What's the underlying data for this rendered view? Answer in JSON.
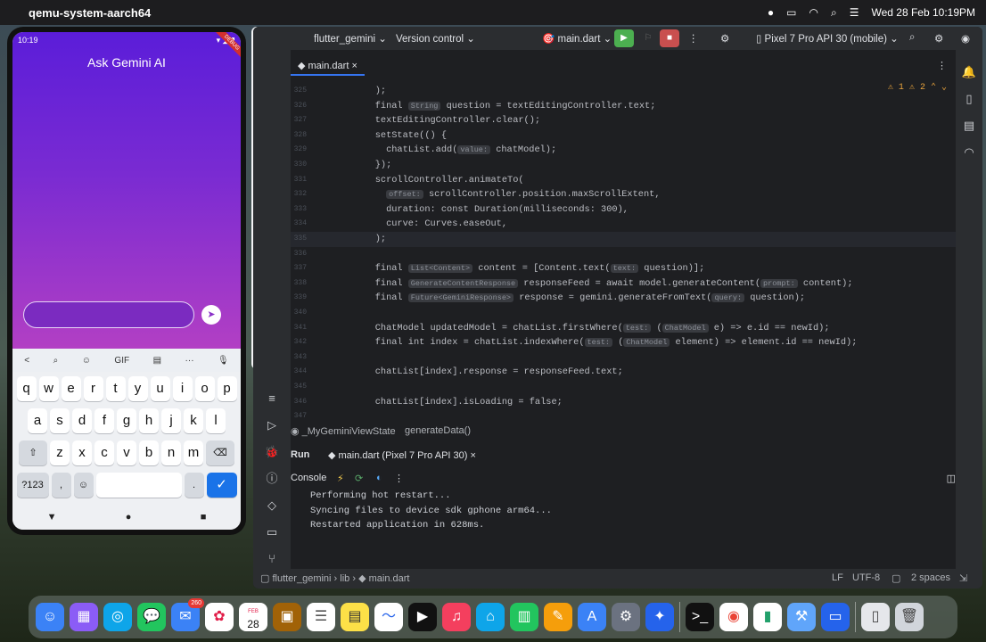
{
  "menubar": {
    "app_name": "qemu-system-aarch64",
    "datetime": "Wed 28 Feb  10:19PM"
  },
  "phone": {
    "time": "10:19",
    "app_title": "Ask Gemini AI",
    "debug_banner": "DEBUG",
    "input_value": "",
    "keyboard": {
      "toolbar": [
        "<",
        "search-icon",
        "sticker-icon",
        "GIF",
        "clipboard-icon",
        "···",
        "mic-icon"
      ],
      "row1": [
        "q",
        "w",
        "e",
        "r",
        "t",
        "y",
        "u",
        "i",
        "o",
        "p"
      ],
      "row1_digits": [
        "1",
        "2",
        "3",
        "4",
        "5",
        "6",
        "7",
        "8",
        "9",
        "0"
      ],
      "row2": [
        "a",
        "s",
        "d",
        "f",
        "g",
        "h",
        "j",
        "k",
        "l"
      ],
      "row3": [
        "z",
        "x",
        "c",
        "v",
        "b",
        "n",
        "m"
      ],
      "symbols_key": "?123",
      "comma": ",",
      "period": "."
    }
  },
  "ide": {
    "project": "flutter_gemini",
    "vcs": "Version control",
    "run_config": "main.dart",
    "device": "Pixel 7 Pro API 30 (mobile)",
    "file_tab": "main.dart",
    "warnings": "1",
    "weak_warnings": "2",
    "breadcrumb": [
      "_MyGeminiViewState",
      "generateData()"
    ],
    "run_label": "Run",
    "run_tab": "main.dart (Pixel 7 Pro API 30)",
    "console_label": "Console",
    "console_lines": [
      "Performing hot restart...",
      "Syncing files to device sdk gphone arm64...",
      "Restarted application in 628ms."
    ],
    "status_path": [
      "flutter_gemini",
      "lib",
      "main.dart"
    ],
    "status_right": [
      "LF",
      "UTF-8",
      "2 spaces"
    ],
    "line_numbers": [
      "325",
      "326",
      "327",
      "328",
      "329",
      "330",
      "331",
      "332",
      "333",
      "334",
      "335",
      "336",
      "337",
      "338",
      "339",
      "340",
      "341",
      "342",
      "343",
      "344",
      "345",
      "346",
      "347"
    ],
    "code_lines": [
      "    );",
      "    final ‹String› question = textEditingController.text;",
      "    textEditingController.clear();",
      "    setState(() {",
      "      chatList.add(‹value:› chatModel);",
      "    });",
      "    scrollController.animateTo(",
      "      ‹offset:› scrollController.position.maxScrollExtent,",
      "      duration: const Duration(milliseconds: 300),",
      "      curve: Curves.easeOut,",
      "    );",
      "",
      "    final ‹List<Content>› content = [Content.text(‹text:› question)];",
      "    final ‹GenerateContentResponse› responseFeed = await model.generateContent(‹prompt:› content);",
      "    final ‹Future<GeminiResponse>› response = gemini.generateFromText(‹query:› question);",
      "",
      "    ChatModel updatedModel = chatList.firstWhere(‹test:› (‹ChatModel› e) => e.id == newId);",
      "    final int index = chatList.indexWhere(‹test:› (‹ChatModel› element) => element.id == newId);",
      "",
      "    chatList[index].response = responseFeed.text;",
      "",
      "    chatList[index].isLoading = false;",
      ""
    ]
  },
  "dock": {
    "mail_badge": "260",
    "calendar_day": "28",
    "calendar_month": "FEB"
  }
}
